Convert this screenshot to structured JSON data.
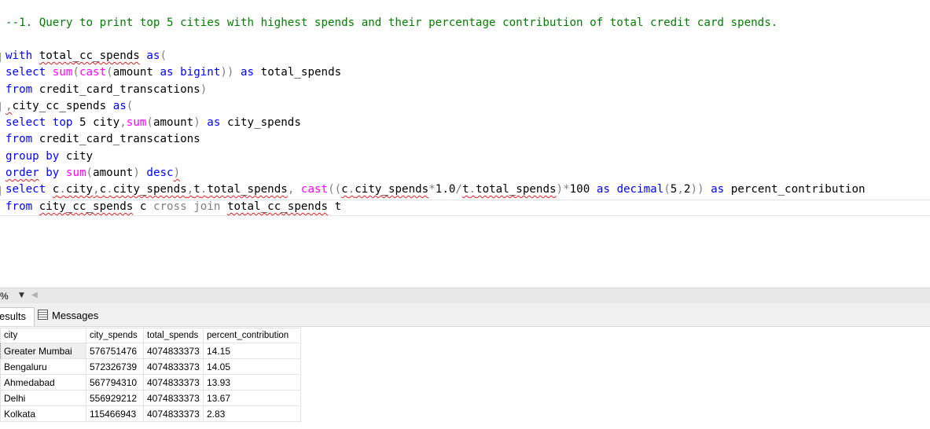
{
  "editor": {
    "comment": "--1. Query to print top 5 cities with highest spends and their percentage contribution of total credit card spends.",
    "l1": {
      "with": "with",
      "cte1": "total_cc_spends",
      "as": "as",
      "open": "("
    },
    "l2": {
      "select": "select",
      "sum": "sum",
      "p1": "(",
      "cast": "cast",
      "p2": "(",
      "amount": "amount ",
      "as": "as",
      "bigint": "bigint",
      "close": "))",
      "as2": "as",
      "alias": "total_spends"
    },
    "l3": {
      "from": "from",
      "table": "credit_card_transcations",
      "close": ")"
    },
    "l4": {
      "comma": ",",
      "cte2": "city_cc_spends",
      "as": "as",
      "open": "("
    },
    "l5": {
      "select": "select",
      "top": "top",
      "n": "5",
      "city": "city",
      "comma": ",",
      "sum": "sum",
      "p1": "(",
      "amount": "amount",
      "p2": ")",
      "as": "as",
      "alias": "city_spends"
    },
    "l6": {
      "from": "from",
      "table": "credit_card_transcations"
    },
    "l7": {
      "group": "group",
      "by": "by",
      "col": "city"
    },
    "l8": {
      "order": "order",
      "by": "by",
      "sum": "sum",
      "p1": "(",
      "amount": "amount",
      "p2": ")",
      "desc": "desc",
      "close": ")"
    },
    "l9": {
      "select": "select",
      "c1": "c",
      "d1": ".",
      "city": "city",
      "cm1": ",",
      "c2": "c",
      "d2": ".",
      "cs": "city_spends",
      "cm2": ",",
      "t1": "t",
      "d3": ".",
      "ts": "total_spends",
      "cm3": ",",
      "cast": "cast",
      "p1": "((",
      "c3": "c",
      "d4": ".",
      "cs2": "city_spends",
      "mul": "*",
      "onept": "1.0",
      "div": "/",
      "t2": "t",
      "d5": ".",
      "ts2": "total_spends",
      "p2": ")",
      "mul2": "*",
      "hundred": "100",
      "as": "as",
      "decimal": "decimal",
      "p3": "(",
      "prec": "5",
      "cm4": ",",
      "scale": "2",
      "p4": "))",
      "as2": "as",
      "alias": "percent_contribution"
    },
    "l10": {
      "from": "from",
      "cte2": "city_cc_spends",
      "c": "c",
      "cross": "cross",
      "join": "join",
      "cte1": "total_cc_spends",
      "t": "t"
    }
  },
  "toolbar": {
    "zoom": "%"
  },
  "tabs": {
    "results": "esults",
    "messages": "Messages"
  },
  "results": {
    "columns": [
      "city",
      "city_spends",
      "total_spends",
      "percent_contribution"
    ],
    "rows": [
      [
        "Greater Mumbai",
        "576751476",
        "4074833373",
        "14.15"
      ],
      [
        "Bengaluru",
        "572326739",
        "4074833373",
        "14.05"
      ],
      [
        "Ahmedabad",
        "567794310",
        "4074833373",
        "13.93"
      ],
      [
        "Delhi",
        "556929212",
        "4074833373",
        "13.67"
      ],
      [
        "Kolkata",
        "115466943",
        "4074833373",
        "2.83"
      ]
    ]
  },
  "colors": {
    "keyword": "#0000ff",
    "function": "#ff00ff",
    "operator": "#808080",
    "comment": "#008000",
    "squiggle": "#e02020"
  }
}
